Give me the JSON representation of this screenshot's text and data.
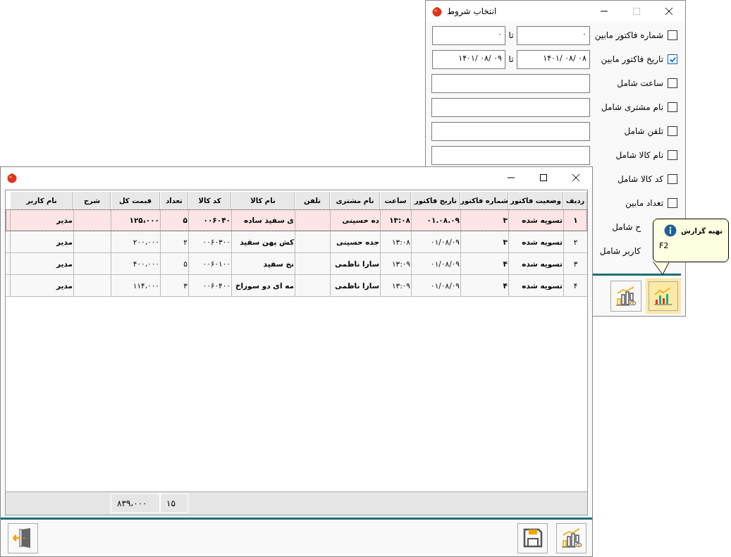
{
  "conditions_window": {
    "title": "انتخاب شروط",
    "maximize_disabled": true,
    "rows": [
      {
        "kind": "range",
        "label": "شماره فاکتور مابین",
        "checked": false,
        "from": "۰",
        "to_label": "تا",
        "to": "۰"
      },
      {
        "kind": "range",
        "label": "تاریخ فاکتور مابین",
        "checked": true,
        "from": "۰۸ /۰۸ /۱۴۰۱",
        "to_label": "تا",
        "to": "۰۹ /۰۸ /۱۴۰۱"
      },
      {
        "kind": "text",
        "label": "ساعت شامل",
        "checked": false
      },
      {
        "kind": "text",
        "label": "نام مشتری شامل",
        "checked": false
      },
      {
        "kind": "text",
        "label": "تلفن شامل",
        "checked": false
      },
      {
        "kind": "text",
        "label": "نام کالا شامل",
        "checked": false
      },
      {
        "kind": "plain",
        "label": "کد کالا شامل",
        "checked": false
      },
      {
        "kind": "plain",
        "label": "تعداد مابین",
        "checked": false
      },
      {
        "kind": "covered",
        "label": "ح شامل"
      },
      {
        "kind": "covered",
        "label": "کاربر شامل"
      }
    ]
  },
  "tooltip": {
    "title": "تهیه گزارش",
    "shortcut": "F2"
  },
  "report_window": {
    "columns": [
      "ردیف",
      "وضعیت فاکتور",
      "شماره فاکتور",
      "تاریخ فاکتور",
      "ساعت",
      "نام مشتری",
      "تلفن",
      "نام کالا",
      "کد کالا",
      "تعداد",
      "قیمت کل",
      "شرح",
      "نام کاربر"
    ],
    "rows": [
      {
        "selected": true,
        "cells": [
          "۱",
          "تسویه شده",
          "۳",
          "۰۱.۰۸.۰۹",
          "۱۳:۰۸",
          "ده حسینی",
          "",
          "ی سفید ساده",
          "۰۰۶۰۴۰",
          "۵",
          "۱۲۵،۰۰۰",
          "",
          "مدیر"
        ]
      },
      {
        "selected": false,
        "cells": [
          "۲",
          "تسویه شده",
          "۳",
          "۰۱/۰۸/۰۹",
          "۱۳:۰۸",
          "جده حسینی",
          "",
          "کش پهن سفید",
          "۰۰۶۰۳۰۰",
          "۲",
          "۲۰۰،۰۰۰",
          "",
          "مدیر"
        ]
      },
      {
        "selected": false,
        "cells": [
          "۳",
          "تسویه شده",
          "۴",
          "۰۱/۰۸/۰۹",
          "۱۳:۰۹",
          "سارا ناظمی",
          "",
          "نخ سفید",
          "۰۰۶۰۱۰۰",
          "۵",
          "۴۰۰،۰۰۰",
          "",
          "مدیر"
        ]
      },
      {
        "selected": false,
        "cells": [
          "۴",
          "تسویه شده",
          "۴",
          "۰۱/۰۸/۰۹",
          "۱۳:۰۹",
          "سارا ناظمی",
          "",
          "مه ای دو سوراخ",
          "۰۰۶۰۴۰۰",
          "۳",
          "۱۱۴،۰۰۰",
          "",
          "مدیر"
        ]
      }
    ],
    "totals": {
      "count": "۱۵",
      "total_price": "۸۳۹،۰۰۰"
    }
  }
}
